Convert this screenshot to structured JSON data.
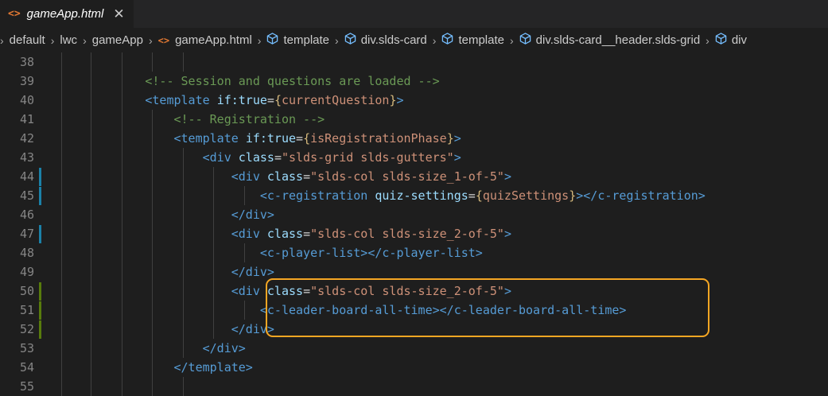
{
  "tab": {
    "icon": "<>",
    "title": "gameApp.html",
    "close": "✕"
  },
  "breadcrumb": [
    {
      "label": "default",
      "icon": ""
    },
    {
      "label": "lwc",
      "icon": ""
    },
    {
      "label": "gameApp",
      "icon": ""
    },
    {
      "label": "gameApp.html",
      "icon": "html-icon"
    },
    {
      "label": "template",
      "icon": "cube-icon"
    },
    {
      "label": "div.slds-card",
      "icon": "cube-icon"
    },
    {
      "label": "template",
      "icon": "cube-icon"
    },
    {
      "label": "div.slds-card__header.slds-grid",
      "icon": "cube-icon"
    },
    {
      "label": "div",
      "icon": "cube-icon"
    }
  ],
  "colors": {
    "gutter_modified": "#1b81a8",
    "gutter_added": "#587c0c",
    "highlight": "#f5a623"
  },
  "lines": [
    {
      "n": "38",
      "mark": "",
      "tokens": []
    },
    {
      "n": "39",
      "mark": "",
      "tokens": [
        [
          "            ",
          "text"
        ],
        [
          "<!-- Session and questions are loaded -->",
          "com"
        ]
      ]
    },
    {
      "n": "40",
      "mark": "",
      "tokens": [
        [
          "            ",
          "text"
        ],
        [
          "<template",
          "tag"
        ],
        [
          " ",
          "text"
        ],
        [
          "if:true",
          "attr"
        ],
        [
          "=",
          "text"
        ],
        [
          "{",
          "brace"
        ],
        [
          "currentQuestion",
          "expr"
        ],
        [
          "}",
          "brace"
        ],
        [
          ">",
          "tag"
        ]
      ]
    },
    {
      "n": "41",
      "mark": "",
      "tokens": [
        [
          "                ",
          "text"
        ],
        [
          "<!-- Registration -->",
          "com"
        ]
      ]
    },
    {
      "n": "42",
      "mark": "",
      "tokens": [
        [
          "                ",
          "text"
        ],
        [
          "<template",
          "tag"
        ],
        [
          " ",
          "text"
        ],
        [
          "if:true",
          "attr"
        ],
        [
          "=",
          "text"
        ],
        [
          "{",
          "brace"
        ],
        [
          "isRegistrationPhase",
          "expr"
        ],
        [
          "}",
          "brace"
        ],
        [
          ">",
          "tag"
        ]
      ]
    },
    {
      "n": "43",
      "mark": "",
      "tokens": [
        [
          "                    ",
          "text"
        ],
        [
          "<div",
          "tag"
        ],
        [
          " ",
          "text"
        ],
        [
          "class",
          "attr"
        ],
        [
          "=",
          "text"
        ],
        [
          "\"slds-grid slds-gutters\"",
          "str"
        ],
        [
          ">",
          "tag"
        ]
      ]
    },
    {
      "n": "44",
      "mark": "modified",
      "tokens": [
        [
          "                        ",
          "text"
        ],
        [
          "<div",
          "tag"
        ],
        [
          " ",
          "text"
        ],
        [
          "class",
          "attr"
        ],
        [
          "=",
          "text"
        ],
        [
          "\"slds-col slds-size_1-of-5\"",
          "str"
        ],
        [
          ">",
          "tag"
        ]
      ]
    },
    {
      "n": "45",
      "mark": "modified",
      "tokens": [
        [
          "                            ",
          "text"
        ],
        [
          "<c-registration",
          "tag"
        ],
        [
          " ",
          "text"
        ],
        [
          "quiz-settings",
          "attr"
        ],
        [
          "=",
          "text"
        ],
        [
          "{",
          "brace"
        ],
        [
          "quizSettings",
          "expr"
        ],
        [
          "}",
          "brace"
        ],
        [
          "></c-registration>",
          "tag"
        ]
      ]
    },
    {
      "n": "46",
      "mark": "",
      "tokens": [
        [
          "                        ",
          "text"
        ],
        [
          "</div>",
          "tag"
        ]
      ]
    },
    {
      "n": "47",
      "mark": "modified",
      "tokens": [
        [
          "                        ",
          "text"
        ],
        [
          "<div",
          "tag"
        ],
        [
          " ",
          "text"
        ],
        [
          "class",
          "attr"
        ],
        [
          "=",
          "text"
        ],
        [
          "\"slds-col slds-size_2-of-5\"",
          "str"
        ],
        [
          ">",
          "tag"
        ]
      ]
    },
    {
      "n": "48",
      "mark": "",
      "tokens": [
        [
          "                            ",
          "text"
        ],
        [
          "<c-player-list></c-player-list>",
          "tag"
        ]
      ]
    },
    {
      "n": "49",
      "mark": "",
      "tokens": [
        [
          "                        ",
          "text"
        ],
        [
          "</div>",
          "tag"
        ]
      ]
    },
    {
      "n": "50",
      "mark": "added",
      "tokens": [
        [
          "                        ",
          "text"
        ],
        [
          "<div",
          "tag"
        ],
        [
          " ",
          "text"
        ],
        [
          "class",
          "attr"
        ],
        [
          "=",
          "text"
        ],
        [
          "\"slds-col slds-size_2-of-5\"",
          "str"
        ],
        [
          ">",
          "tag"
        ]
      ]
    },
    {
      "n": "51",
      "mark": "added",
      "tokens": [
        [
          "                            ",
          "text"
        ],
        [
          "<c-leader-board-all-time></c-leader-board-all-time>",
          "tag"
        ]
      ]
    },
    {
      "n": "52",
      "mark": "added",
      "tokens": [
        [
          "                        ",
          "text"
        ],
        [
          "</div>",
          "tag"
        ]
      ]
    },
    {
      "n": "53",
      "mark": "",
      "tokens": [
        [
          "                    ",
          "text"
        ],
        [
          "</div>",
          "tag"
        ]
      ]
    },
    {
      "n": "54",
      "mark": "",
      "tokens": [
        [
          "                ",
          "text"
        ],
        [
          "</template>",
          "tag"
        ]
      ]
    },
    {
      "n": "55",
      "mark": "",
      "tokens": []
    }
  ]
}
